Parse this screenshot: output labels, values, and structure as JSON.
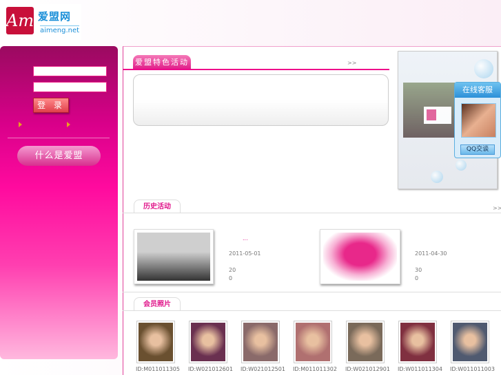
{
  "logo": {
    "mark": "Am",
    "cn": "爱盟网",
    "en": "aimeng.net"
  },
  "sidebar": {
    "login_label": "登 录",
    "what_label": "什么是爱盟"
  },
  "featured": {
    "tab": "爱盟特色活动",
    "more": ">>"
  },
  "service": {
    "title": "在线客服",
    "qq_label": "QQ交谈"
  },
  "history": {
    "tab": "历史活动",
    "more": ">>",
    "items": [
      {
        "title": "...",
        "date": "2011-05-01",
        "count1": "20",
        "count2": "0"
      },
      {
        "title": "",
        "date": "2011-04-30",
        "count1": "30",
        "count2": "0"
      }
    ]
  },
  "members": {
    "tab": "会员照片",
    "items": [
      {
        "id": "ID:M011011305",
        "color": "#6a5030"
      },
      {
        "id": "ID:W021012601",
        "color": "#6a3050"
      },
      {
        "id": "ID:W021012501",
        "color": "#8a6a6a"
      },
      {
        "id": "ID:M011011302",
        "color": "#b07070"
      },
      {
        "id": "ID:W021012901",
        "color": "#7a6a5a"
      },
      {
        "id": "ID:W011011304",
        "color": "#803040"
      },
      {
        "id": "ID:W011011003",
        "color": "#505a70"
      }
    ]
  }
}
